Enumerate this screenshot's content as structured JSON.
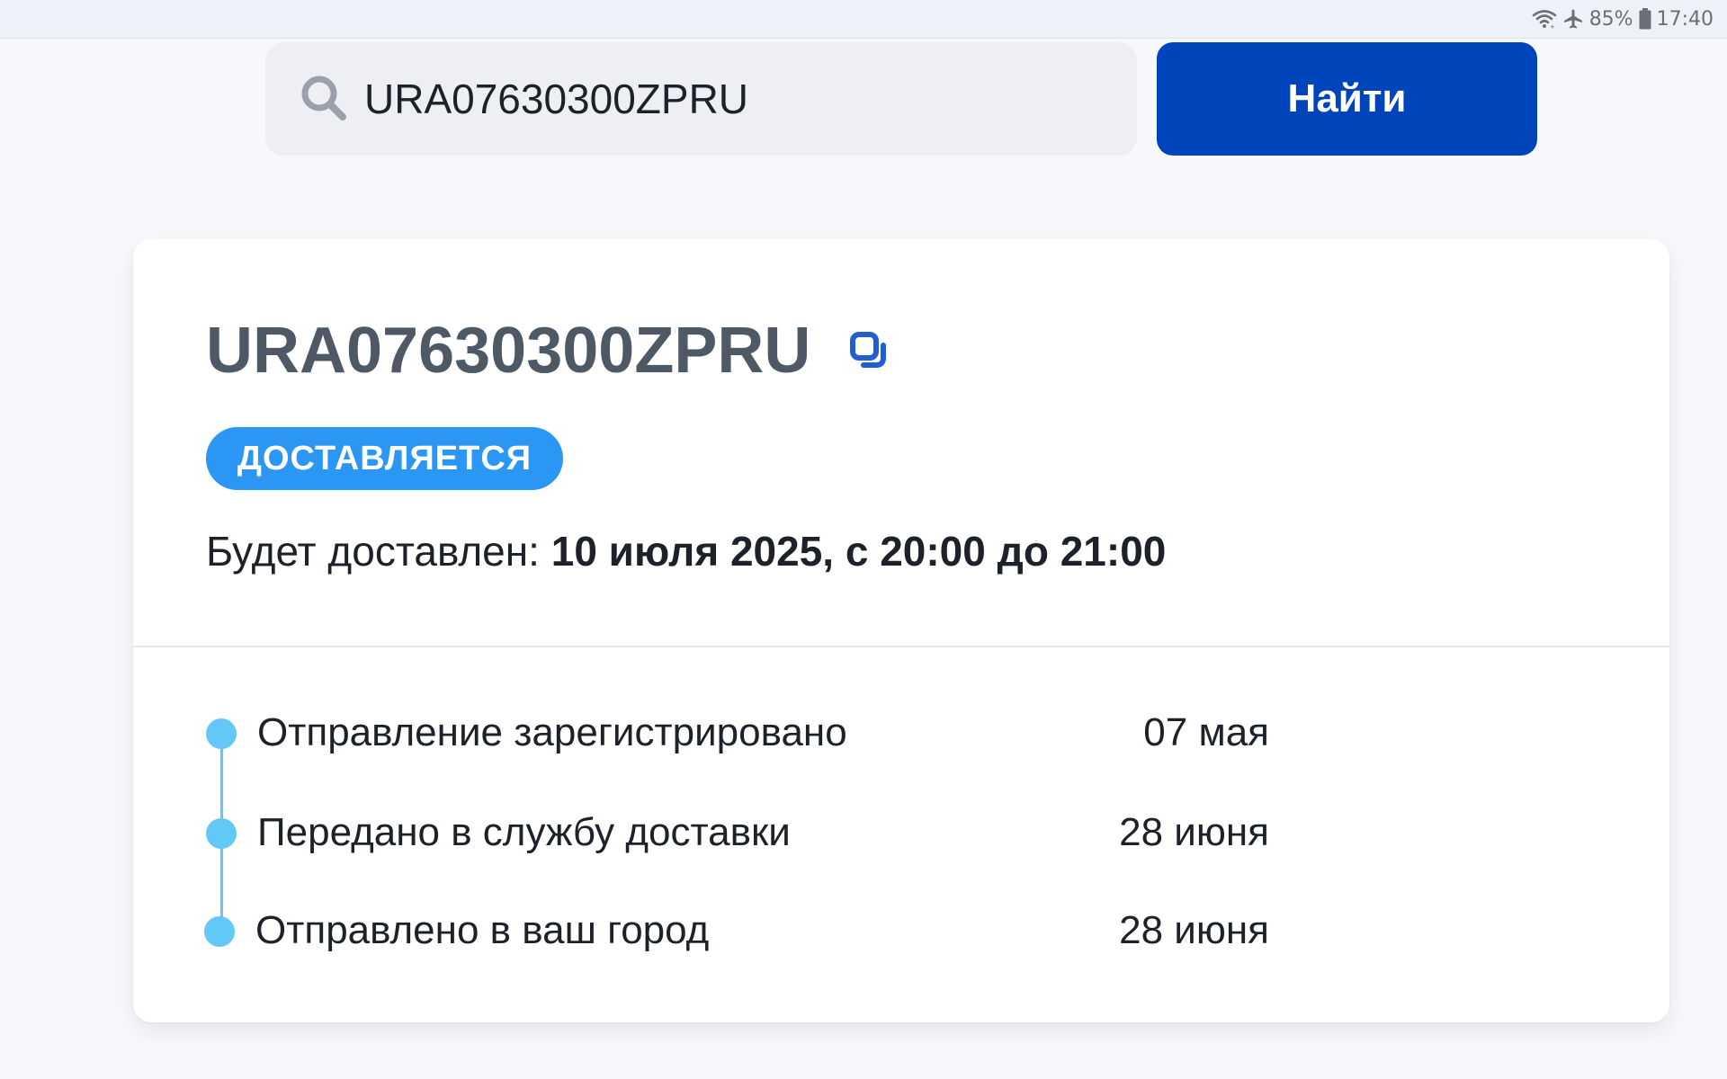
{
  "status_bar": {
    "battery": "85%",
    "time": "17:40",
    "icons": [
      "wifi-icon",
      "airplane-mode-icon",
      "battery-icon"
    ]
  },
  "search": {
    "value": "URA07630300ZPRU",
    "icon": "search-icon",
    "button_label": "Найти"
  },
  "shipment": {
    "tracking_number": "URA07630300ZPRU",
    "copy_icon": "copy-icon",
    "status": "ДОСТАВЛЯЕТСЯ",
    "delivery_label": "Будет доставлен: ",
    "delivery_value": "10 июля 2025, с 20:00 до 21:00"
  },
  "timeline": [
    {
      "label": "Отправление зарегистрировано",
      "date": "07 мая"
    },
    {
      "label": "Передано в службу доставки",
      "date": "28 июня"
    },
    {
      "label": "Отправлено в ваш город",
      "date": "28 июня"
    }
  ],
  "colors": {
    "primary_button": "#0044bb",
    "status_badge": "#2b96f3",
    "timeline_accent": "#61c8f7",
    "title_text": "#4f5966",
    "copy_icon": "#1f5fd1",
    "search_background": "#edeff3",
    "page_background": "#f7f8fb"
  }
}
